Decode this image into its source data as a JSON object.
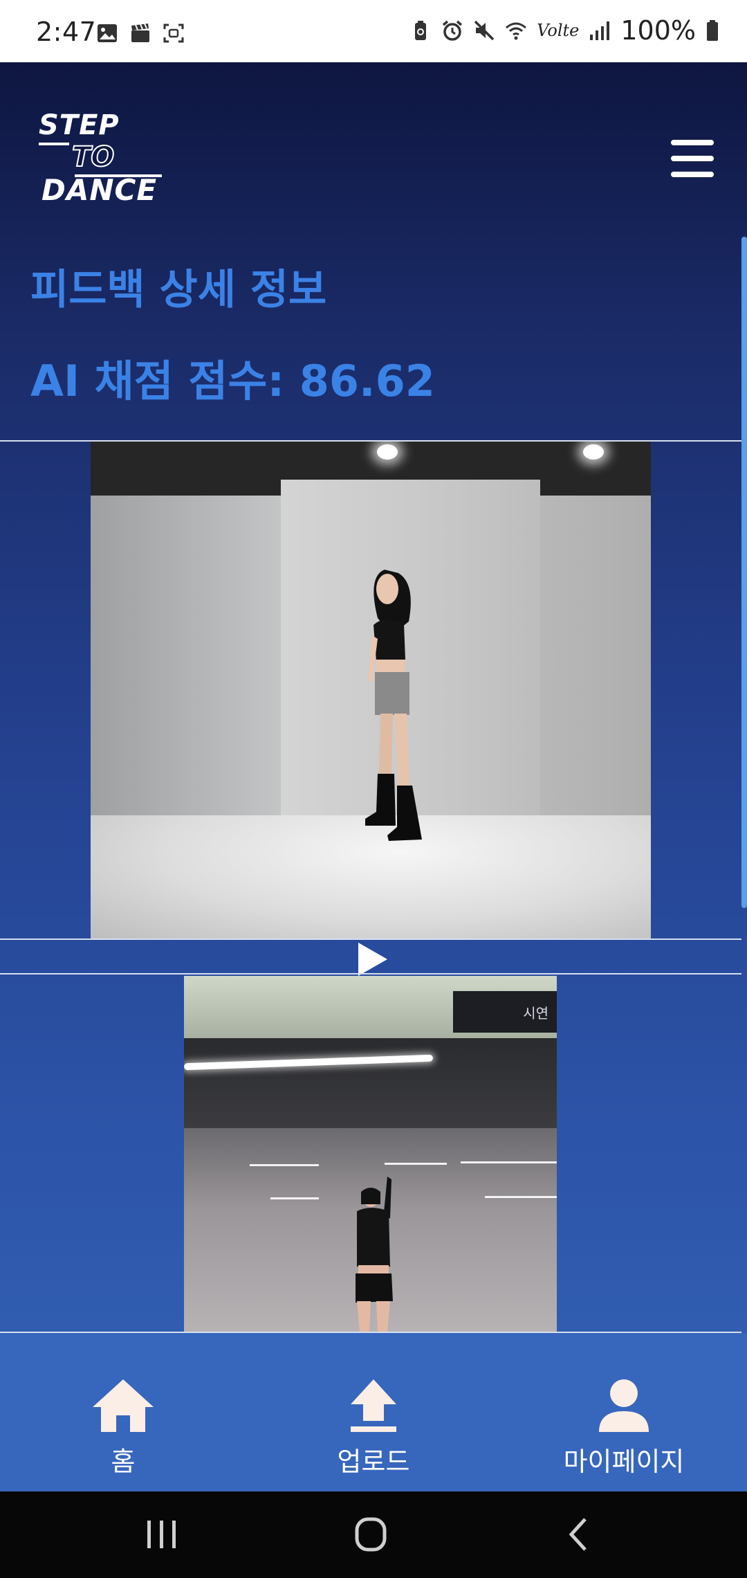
{
  "status_bar": {
    "time": "2:47",
    "left_icons": [
      "gallery-icon",
      "clapperboard-icon",
      "screen-capture-icon"
    ],
    "right_icons": [
      "battery-saver-icon",
      "alarm-icon",
      "mute-icon",
      "wifi-icon",
      "volte-icon",
      "signal-icon",
      "battery-icon"
    ],
    "volte_label": "Volte",
    "battery_percent": "100%"
  },
  "header": {
    "logo_line1": "STEP",
    "logo_line2": "TO",
    "logo_line3": "DANCE",
    "menu_icon": "hamburger-menu-icon"
  },
  "main": {
    "title": "피드백 상세 정보",
    "score_label": "AI 채점 점수: 86.62"
  },
  "video2": {
    "sign_text": "시연"
  },
  "bottom_nav": {
    "items": [
      {
        "label": "홈",
        "icon": "home-icon"
      },
      {
        "label": "업로드",
        "icon": "upload-icon"
      },
      {
        "label": "마이페이지",
        "icon": "person-icon"
      }
    ]
  },
  "system_nav": {
    "buttons": [
      "recent-apps-icon",
      "home-circle-icon",
      "back-icon"
    ]
  },
  "colors": {
    "accent_text": "#3b82e6",
    "bottom_nav_bg": "#3766bd",
    "header_dark": "#0e1640",
    "nav_icon": "#fbeee6"
  }
}
